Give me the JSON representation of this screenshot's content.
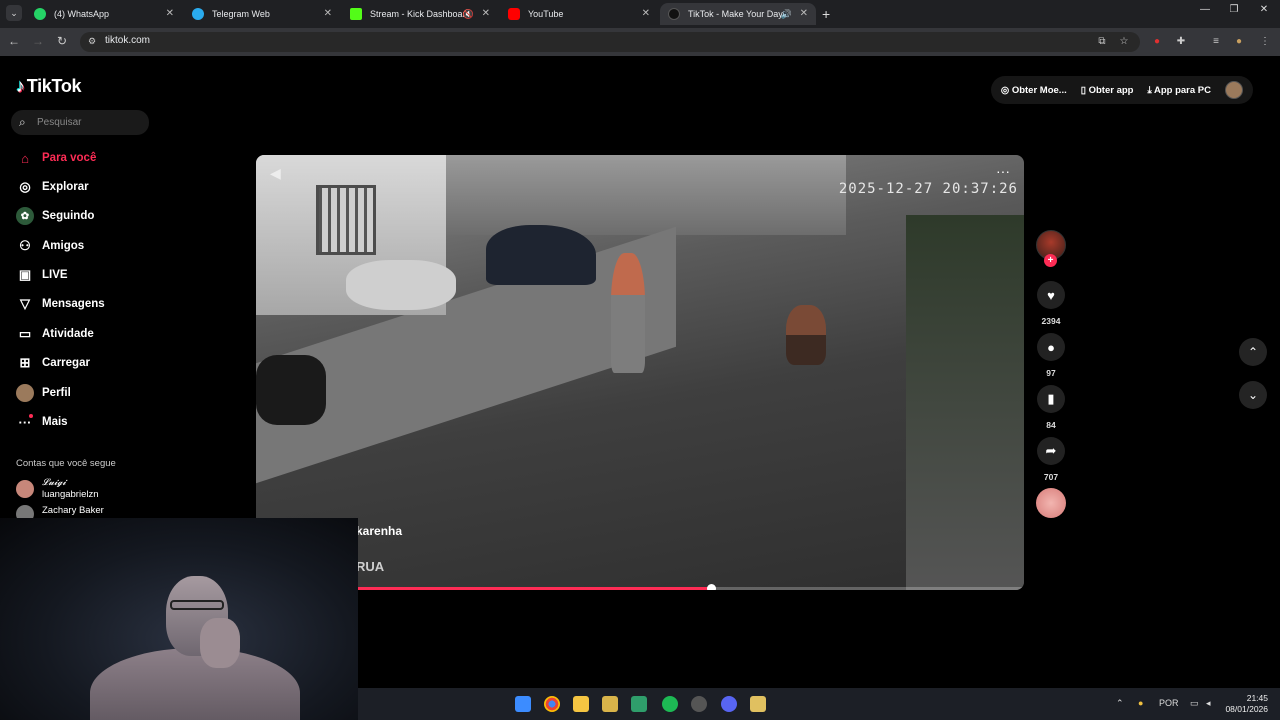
{
  "browser": {
    "tabs": [
      {
        "title": "(4) WhatsApp",
        "color": "#25d366",
        "active": false
      },
      {
        "title": "Telegram Web",
        "color": "#2aabee",
        "active": false
      },
      {
        "title": "Stream - Kick Dashboard",
        "color": "#53fc18",
        "active": false
      },
      {
        "title": "YouTube",
        "color": "#ff0000",
        "active": false
      },
      {
        "title": "TikTok - Make Your Day",
        "color": "#111111",
        "active": true
      }
    ],
    "url": "tiktok.com"
  },
  "tiktok": {
    "logo_text": "TikTok",
    "search_placeholder": "Pesquisar",
    "nav": [
      {
        "label": "Para você",
        "icon": "home-icon",
        "active": true
      },
      {
        "label": "Explorar",
        "icon": "compass-icon",
        "active": false
      },
      {
        "label": "Seguindo",
        "icon": "following-icon",
        "active": false
      },
      {
        "label": "Amigos",
        "icon": "friends-icon",
        "active": false
      },
      {
        "label": "LIVE",
        "icon": "live-icon",
        "active": false
      },
      {
        "label": "Mensagens",
        "icon": "messages-icon",
        "active": false
      },
      {
        "label": "Atividade",
        "icon": "activity-icon",
        "active": false
      },
      {
        "label": "Carregar",
        "icon": "upload-icon",
        "active": false
      },
      {
        "label": "Perfil",
        "icon": "profile-avatar",
        "active": false
      },
      {
        "label": "Mais",
        "icon": "more-icon",
        "active": false
      }
    ],
    "following_title": "Contas que você segue",
    "following_accounts": [
      {
        "display": "𝓛𝓾𝓲𝓰𝓲",
        "username": "luangabrielzn"
      },
      {
        "display": "",
        "username": "Zachary Baker"
      }
    ],
    "top_right": {
      "coins": "Obter Moe...",
      "get_app": "Obter app",
      "pc_app": "App para PC"
    },
    "video": {
      "timestamp": "2025-12-27 20:37:26",
      "author": "karenha",
      "caption": "RUA",
      "progress_fraction": 0.592
    },
    "actions": {
      "likes": "2394",
      "comments": "97",
      "saves": "84",
      "shares": "707"
    }
  },
  "taskbar": {
    "language": "POR",
    "time": "21:45",
    "date": "08/01/2026"
  },
  "colors": {
    "accent": "#fe2c55",
    "background": "#000000"
  }
}
